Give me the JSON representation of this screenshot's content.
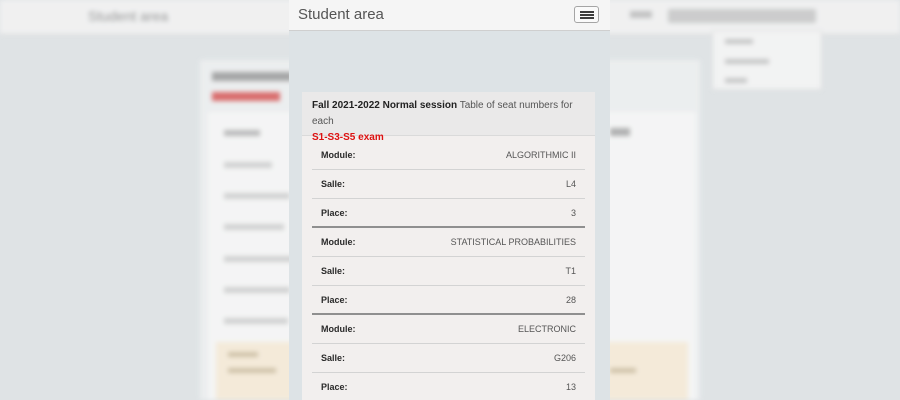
{
  "background": {
    "brand": "Student area"
  },
  "navbar": {
    "brand": "Student area",
    "menu_icon": "hamburger-menu-icon"
  },
  "card": {
    "session": "Fall 2021-2022 Normal session",
    "description": "Table of seat numbers for each",
    "exam": "S1-S3-S5 exam",
    "groups": [
      {
        "module_label": "Module:",
        "module_value": "ALGORITHMIC II",
        "salle_label": "Salle:",
        "salle_value": "L4",
        "place_label": "Place:",
        "place_value": "3"
      },
      {
        "module_label": "Module:",
        "module_value": "STATISTICAL PROBABILITIES",
        "salle_label": "Salle:",
        "salle_value": "T1",
        "place_label": "Place:",
        "place_value": "28"
      },
      {
        "module_label": "Module:",
        "module_value": "ELECTRONIC",
        "salle_label": "Salle:",
        "salle_value": "G206",
        "place_label": "Place:",
        "place_value": "13"
      }
    ]
  },
  "colors": {
    "accent_red": "#dd1111",
    "navbar_bg": "#f5f5f5",
    "card_bg": "#f2efee"
  }
}
